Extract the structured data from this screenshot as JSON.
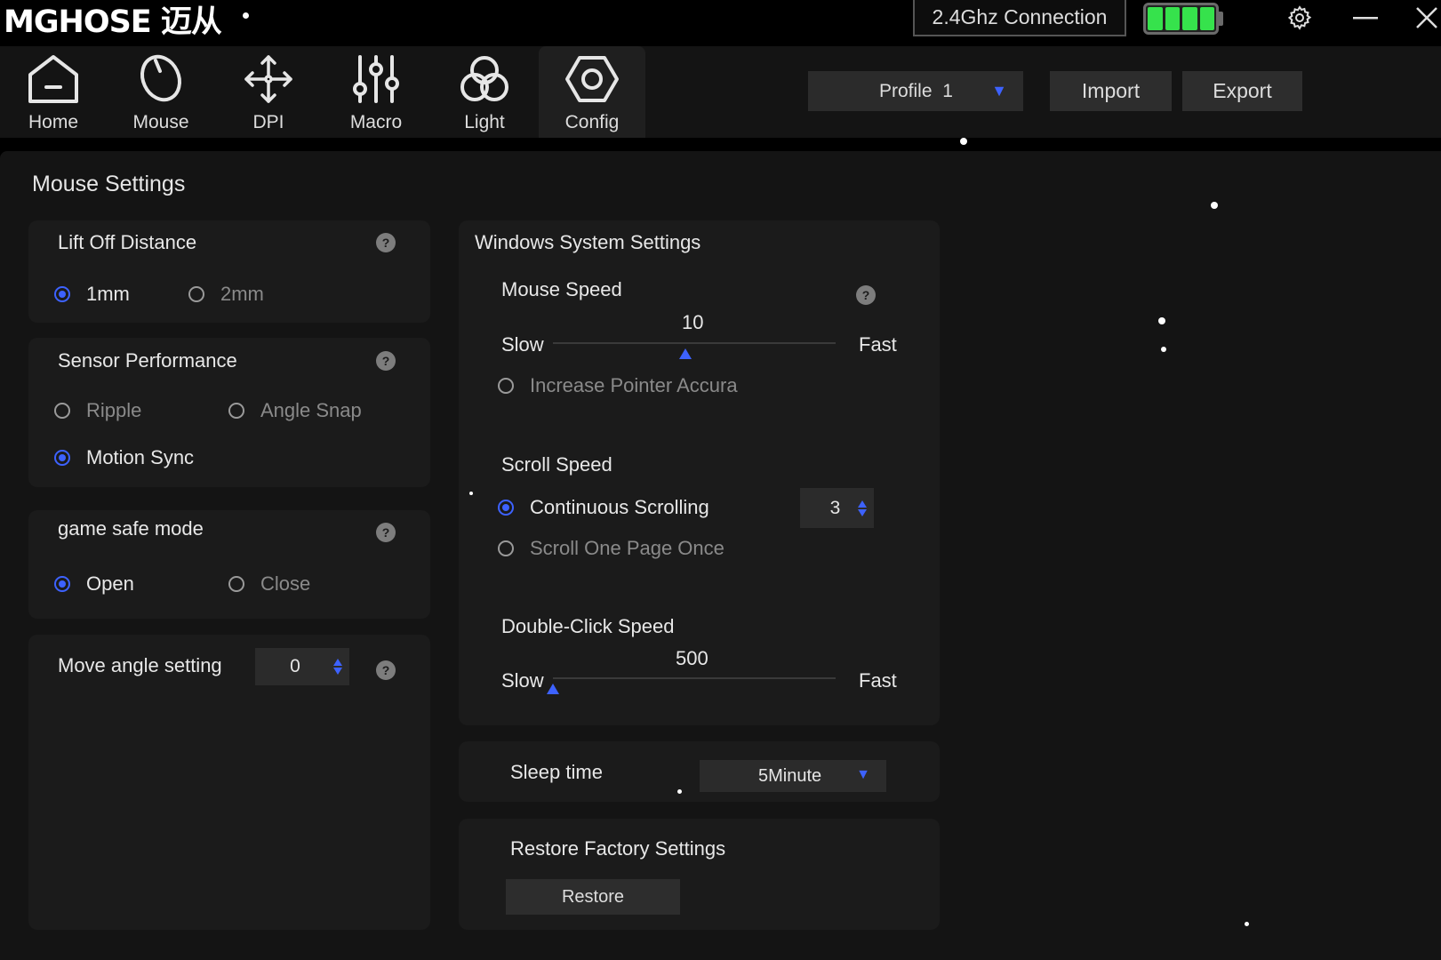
{
  "app": {
    "logo": "MGHOSE 迈从"
  },
  "titlebar": {
    "connection": "2.4Ghz Connection",
    "battery_level": 1.0,
    "battery_color": "#36e24c"
  },
  "nav": {
    "items": [
      {
        "label": "Home",
        "icon": "home-icon"
      },
      {
        "label": "Mouse",
        "icon": "mouse-icon"
      },
      {
        "label": "DPI",
        "icon": "dpi-move-icon"
      },
      {
        "label": "Macro",
        "icon": "macro-sliders-icon"
      },
      {
        "label": "Light",
        "icon": "light-circles-icon"
      },
      {
        "label": "Config",
        "icon": "config-hexagon-icon"
      }
    ],
    "active": "Config"
  },
  "toolbar": {
    "profile": "Profile  1",
    "import_label": "Import",
    "export_label": "Export"
  },
  "mouse_settings": {
    "title": "Mouse Settings",
    "lift_off": {
      "title": "Lift Off Distance",
      "options": [
        "1mm",
        "2mm"
      ],
      "selected": "1mm"
    },
    "sensor": {
      "title": "Sensor Performance",
      "options": [
        "Ripple",
        "Angle Snap",
        "Motion Sync"
      ],
      "selected": "Motion Sync"
    },
    "game_safe": {
      "title": "game safe mode",
      "options": [
        "Open",
        "Close"
      ],
      "selected": "Open"
    },
    "move_angle": {
      "title": "Move angle setting",
      "value": "0"
    }
  },
  "windows_settings": {
    "title": "Windows System Settings",
    "mouse_speed": {
      "title": "Mouse Speed",
      "slow": "Slow",
      "fast": "Fast",
      "value": "10",
      "fraction": 0.47,
      "pointer_accuracy": "Increase Pointer Accura",
      "pointer_accuracy_checked": false
    },
    "scroll_speed": {
      "title": "Scroll Speed",
      "continuous": "Continuous Scrolling",
      "one_page": "Scroll One Page Once",
      "selected": "Continuous Scrolling",
      "lines": "3"
    },
    "double_click": {
      "title": "Double-Click Speed",
      "slow": "Slow",
      "fast": "Fast",
      "value": "500",
      "fraction": 0.0
    }
  },
  "sleep": {
    "label": "Sleep time",
    "value": "5Minute"
  },
  "restore": {
    "title": "Restore Factory Settings",
    "button": "Restore"
  },
  "accent_color": "#3d62ff"
}
